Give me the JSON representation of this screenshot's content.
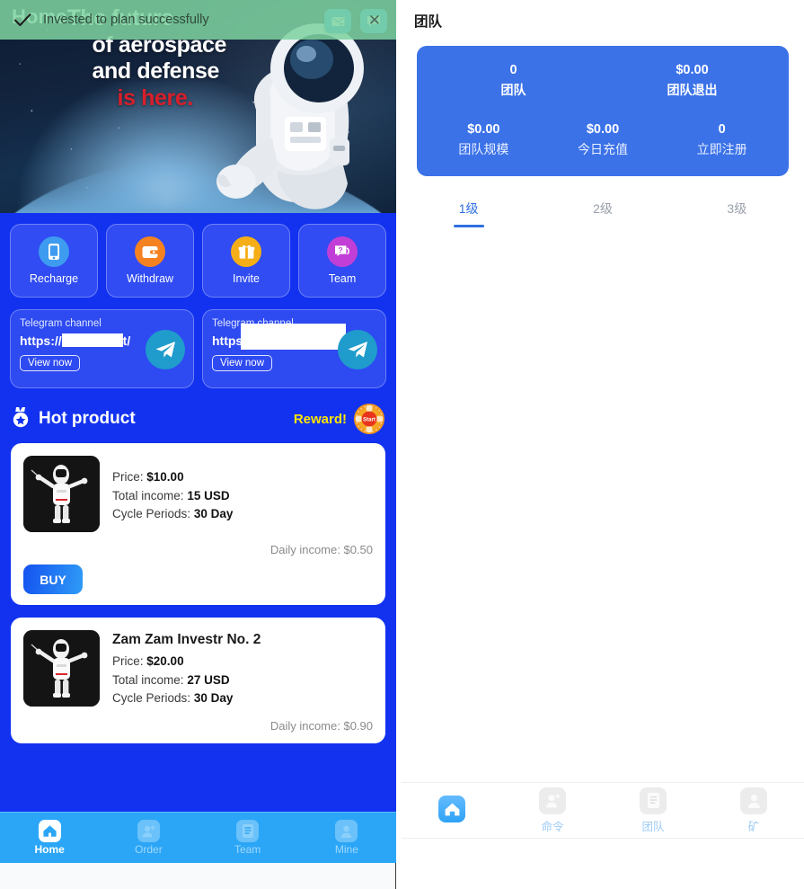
{
  "toast": {
    "message": "Invested to plan successfully",
    "check_icon": "check-icon",
    "close_icon": "close-icon"
  },
  "left": {
    "hero": {
      "home_label": "Home",
      "line1": "The future",
      "line2": "of aerospace",
      "line3": "and defense",
      "line4": "is here.",
      "icons": [
        "mail-icon",
        "chat-bubble-icon"
      ]
    },
    "quick_actions": [
      {
        "label": "Recharge",
        "icon": "phone-icon",
        "color": "#3d9bf0"
      },
      {
        "label": "Withdraw",
        "icon": "wallet-icon",
        "color": "#f58220"
      },
      {
        "label": "Invite",
        "icon": "gift-icon",
        "color": "#f5ae17"
      },
      {
        "label": "Team",
        "icon": "question-chat-icon",
        "color": "#c13fd6"
      }
    ],
    "telegram": [
      {
        "title": "Telegram channel",
        "url_prefix": "https://",
        "url_suffix": "t/",
        "button": "View now",
        "icon": "telegram-icon"
      },
      {
        "title": "Telegram channel",
        "url_prefix": "https",
        "url_suffix": "",
        "button": "View now",
        "icon": "telegram-icon"
      }
    ],
    "hot": {
      "title": "Hot product",
      "icon": "medal-star-icon",
      "reward_label": "Reward!",
      "reward_icon": "start-wheel-icon",
      "reward_text": "Start"
    },
    "products": [
      {
        "name": "",
        "price_label": "Price:",
        "price": "$10.00",
        "income_label": "Total income:",
        "income": "15 USD",
        "cycle_label": "Cycle Periods:",
        "cycle": "30 Day",
        "daily": "Daily income: $0.50",
        "buy_label": "BUY"
      },
      {
        "name": "Zam Zam Investr No. 2",
        "price_label": "Price:",
        "price": "$20.00",
        "income_label": "Total income:",
        "income": "27 USD",
        "cycle_label": "Cycle Periods:",
        "cycle": "30 Day",
        "daily": "Daily income: $0.90",
        "buy_label": ""
      }
    ],
    "nav": [
      {
        "label": "Home",
        "icon": "home-icon",
        "active": true
      },
      {
        "label": "Order",
        "icon": "user-plus-icon",
        "active": false
      },
      {
        "label": "Team",
        "icon": "document-icon",
        "active": false
      },
      {
        "label": "Mine",
        "icon": "user-icon",
        "active": false
      }
    ]
  },
  "right": {
    "title": "团队",
    "stats_top": [
      {
        "value": "0",
        "label": "团队"
      },
      {
        "value": "$0.00",
        "label": "团队退出"
      }
    ],
    "stats_bottom": [
      {
        "value": "$0.00",
        "label": "团队规模"
      },
      {
        "value": "$0.00",
        "label": "今日充值"
      },
      {
        "value": "0",
        "label": "立即注册"
      }
    ],
    "level_tabs": [
      {
        "label": "1级",
        "active": true
      },
      {
        "label": "2级",
        "active": false
      },
      {
        "label": "3级",
        "active": false
      }
    ],
    "nav": [
      {
        "label": "",
        "icon": "home-icon",
        "active": true
      },
      {
        "label": "命令",
        "icon": "user-plus-icon",
        "active": false
      },
      {
        "label": "团队",
        "icon": "document-icon",
        "active": false
      },
      {
        "label": "矿",
        "icon": "user-icon",
        "active": false
      }
    ]
  },
  "colors": {
    "app_blue": "#1232f0",
    "nav_blue": "#2ba6f7",
    "card_blue": "#3b72e8",
    "accent_blue": "#2f6fe0",
    "toast_green": "#7ed3a0",
    "reward_yellow": "#ffe600"
  }
}
